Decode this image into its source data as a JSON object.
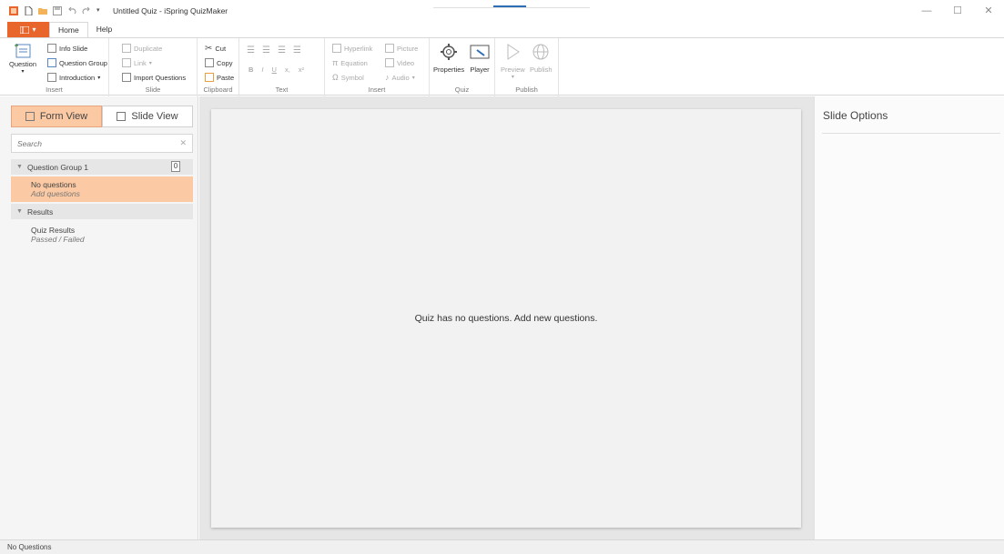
{
  "titlebar": {
    "title": "Untitled Quiz - iSpring QuizMaker",
    "controls": {
      "minimize": "—",
      "maximize": "☐",
      "close": "✕"
    }
  },
  "tabs": {
    "file_icon": "menu-grid-icon",
    "file_arrow": "▾",
    "items": [
      {
        "label": "Home"
      },
      {
        "label": "Help"
      }
    ]
  },
  "ribbon": {
    "insert": {
      "question_label": "Question",
      "info_slide": "Info Slide",
      "question_group": "Question Group",
      "introduction": "Introduction",
      "group_label": "Insert"
    },
    "slide": {
      "duplicate": "Duplicate",
      "link": "Link",
      "import_questions": "Import Questions",
      "group_label": "Slide"
    },
    "clipboard": {
      "cut": "Cut",
      "copy": "Copy",
      "paste": "Paste",
      "group_label": "Clipboard"
    },
    "text": {
      "bold": "B",
      "italic": "I",
      "underline": "U",
      "subscript": "x,",
      "superscript": "x²",
      "group_label": "Text"
    },
    "insert2": {
      "hyperlink": "Hyperlink",
      "picture": "Picture",
      "equation": "Equation",
      "video": "Video",
      "symbol": "Symbol",
      "audio": "Audio",
      "group_label": "Insert"
    },
    "quiz": {
      "properties": "Properties",
      "player": "Player",
      "group_label": "Quiz"
    },
    "publish": {
      "preview": "Preview",
      "publish": "Publish",
      "group_label": "Publish"
    }
  },
  "left_panel": {
    "form_view": "Form View",
    "slide_view": "Slide View",
    "search_placeholder": "Search",
    "groups": [
      {
        "title": "Question Group 1",
        "count": "0",
        "items": [
          {
            "title": "No questions",
            "subtitle": "Add questions"
          }
        ]
      },
      {
        "title": "Results",
        "items": [
          {
            "title": "Quiz Results",
            "subtitle": "Passed / Failed"
          }
        ]
      }
    ]
  },
  "center": {
    "message": "Quiz has no questions. Add new questions."
  },
  "right_panel": {
    "title": "Slide Options"
  },
  "status_bar": {
    "text": "No Questions"
  },
  "colors": {
    "accent": "#e8662c",
    "selection": "#fbc9a3",
    "title_blue": "#2d6fb6"
  }
}
